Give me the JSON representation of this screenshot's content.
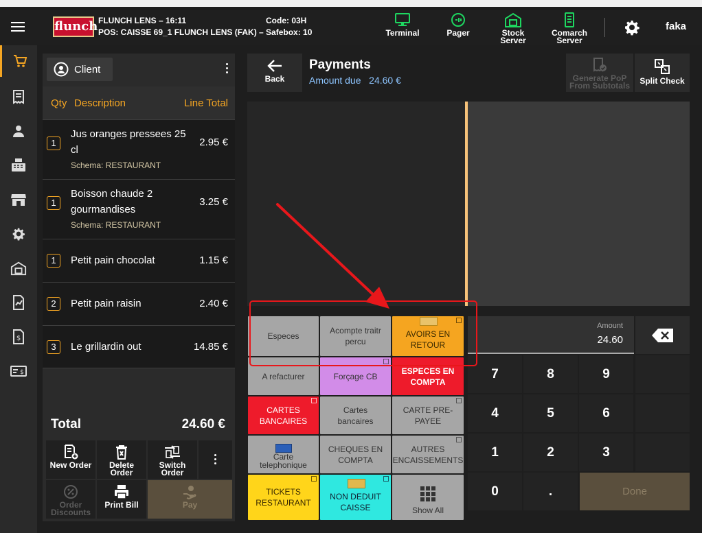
{
  "header": {
    "logo_text": "flunch",
    "store_line": "FLUNCH LENS – 16:11",
    "pos_line": "POS: CAISSE 69_1 FLUNCH LENS (FAK) – Safebox: 10",
    "code": "Code: 03H",
    "buttons": [
      {
        "label": "Terminal",
        "icon": "monitor-icon"
      },
      {
        "label": "Pager",
        "icon": "pager-icon"
      },
      {
        "label1": "Stock",
        "label2": "Server",
        "icon": "warehouse-icon"
      },
      {
        "label1": "Comarch",
        "label2": "Server",
        "icon": "server-icon"
      }
    ],
    "user": "faka",
    "accent": "#1ed760"
  },
  "order": {
    "client_label": "Client",
    "col_qty": "Qty",
    "col_desc": "Description",
    "col_total": "Line Total",
    "lines": [
      {
        "qty": "1",
        "desc": "Jus oranges pressees 25 cl",
        "schema": "Schema: RESTAURANT",
        "total": "2.95 €"
      },
      {
        "qty": "1",
        "desc": "Boisson chaude 2 gourmandises",
        "schema": "Schema: RESTAURANT",
        "total": "3.25 €"
      },
      {
        "qty": "1",
        "desc": "Petit pain chocolat",
        "schema": "",
        "total": "1.15 €"
      },
      {
        "qty": "2",
        "desc": "Petit pain raisin",
        "schema": "",
        "total": "2.40 €"
      },
      {
        "qty": "3",
        "desc": "Le grillardin out",
        "schema": "",
        "total": "14.85 €"
      }
    ],
    "total_label": "Total",
    "total_value": "24.60 €",
    "buttons": {
      "new_order": "New Order",
      "delete1": "Delete",
      "delete2": "Order",
      "switch1": "Switch",
      "switch2": "Order",
      "disc1": "Order",
      "disc2": "Discounts",
      "print": "Print Bill",
      "pay": "Pay"
    }
  },
  "payment": {
    "back": "Back",
    "title": "Payments",
    "amount_due_label": "Amount due",
    "amount_due": "24.60 €",
    "gen1": "Generate PoP",
    "gen2": "From Subtotals",
    "split": "Split Check",
    "amount_label": "Amount",
    "amount_value": "24.60",
    "done": "Done",
    "tiles": {
      "especes": "Especes",
      "acompte1": "Acompte traitr",
      "acompte2": "percu",
      "avoirs1": "AVOIRS EN",
      "avoirs2": "RETOUR",
      "refacturer": "A refacturer",
      "forcage": "Forçage CB",
      "especes_compta1": "ESPECES EN",
      "especes_compta2": "COMPTA",
      "cartes_bancaires1": "CARTES",
      "cartes_bancaires2": "BANCAIRES",
      "cartes_b1": "Cartes",
      "cartes_b2": "bancaires",
      "pre1": "CARTE PRE-",
      "pre2": "PAYEE",
      "tel1": "Carte",
      "tel2": "telephonique",
      "cheques1": "CHEQUES EN",
      "cheques2": "COMPTA",
      "autres1": "AUTRES",
      "autres2": "ENCAISSEMENTS",
      "tickets1": "TICKETS",
      "tickets2": "RESTAURANT",
      "non1": "NON DEDUIT",
      "non2": "CAISSE",
      "showall": "Show All"
    },
    "keys": [
      "7",
      "8",
      "9",
      "4",
      "5",
      "6",
      "1",
      "2",
      "3",
      "0",
      "."
    ]
  }
}
